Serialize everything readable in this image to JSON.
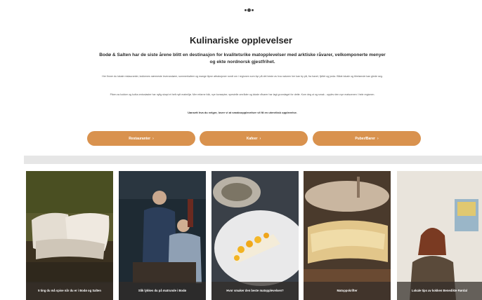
{
  "header": {
    "logo_icon": "logo-dots-icon"
  },
  "main": {
    "title": "Kulinariske opplevelser",
    "subtitle": "Bodø & Salten har de siste årene blitt en destinasjon for kvalitetsrike matopplevelser med arktiske råvarer, velkomponerte menyer og ekte nordnorsk gjestfrihet.",
    "para1": "Her finner du lokale restauranter, kokkenes nærmeste leverandører, sommerkafeer og mange åpne attraksjoner rundt om i regionen som byr på det beste av hva naturen her kan by på, fra havet, fjellet og jorda. Både lokale og tilreisende kan glede seg.",
    "para2": "Piken av kokker og kultur-entusiaster har nylig skapt et helt nytt matmiljø. Mer erfarne folk, nye konsepter, spesielle områder og lokale råvarer har lagt grunnlaget for dette. Kom deg ut og smak - opplev den nye matscenen i hele regionen.",
    "para3": "Uansett hva du velger, lover vi at smaksopplevelser vil få en utenriksk opplevelse.",
    "buttons": [
      {
        "label": "Restauranter",
        "icon": "arrow-right-icon"
      },
      {
        "label": "Kafeer",
        "icon": "arrow-right-icon"
      },
      {
        "label": "Puber/Barer",
        "icon": "arrow-right-icon"
      }
    ]
  },
  "cards": [
    {
      "caption": "5 ting du må spise når du er i Bodø og Salten"
    },
    {
      "caption": "Slik lykkes du på matrunde i Bodø"
    },
    {
      "caption": "Hvor smaker den beste matopplevelsen?"
    },
    {
      "caption": "Matoppskrifter"
    },
    {
      "caption": "Lokale tips av kokken Benedikte Rørdal"
    }
  ]
}
